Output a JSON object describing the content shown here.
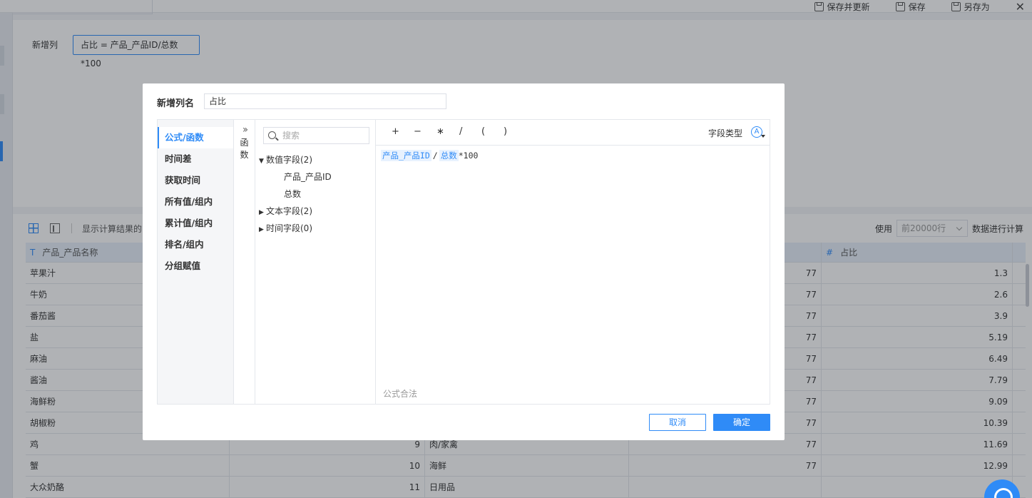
{
  "toolbar": {
    "save_update": "保存并更新",
    "save": "保存",
    "save_as": "另存为",
    "close": "✕"
  },
  "upper": {
    "new_column_label": "新增列",
    "formula_chip": "占比 = 产品_产品ID/总数*100"
  },
  "lower": {
    "show_calc": "显示计算结果的",
    "use_label": "使用",
    "rows_option": "前20000行",
    "calc_suffix": "数据进行计算"
  },
  "table": {
    "headers": [
      {
        "type_icon": "T",
        "label": "产品_产品名称"
      },
      {
        "type_icon": "",
        "label": ""
      },
      {
        "type_icon": "",
        "label": ""
      },
      {
        "type_icon": "",
        "label": ""
      },
      {
        "type_icon": "#",
        "label": "占比"
      }
    ],
    "rows": [
      [
        "苹果汁",
        "",
        "",
        "77",
        "1.3"
      ],
      [
        "牛奶",
        "",
        "",
        "77",
        "2.6"
      ],
      [
        "番茄酱",
        "",
        "",
        "77",
        "3.9"
      ],
      [
        "盐",
        "",
        "",
        "77",
        "5.19"
      ],
      [
        "麻油",
        "",
        "",
        "77",
        "6.49"
      ],
      [
        "酱油",
        "",
        "",
        "77",
        "7.79"
      ],
      [
        "海鲜粉",
        "",
        "",
        "77",
        "9.09"
      ],
      [
        "胡椒粉",
        "",
        "",
        "77",
        "10.39"
      ],
      [
        "鸡",
        "9",
        "肉/家禽",
        "77",
        "11.69"
      ],
      [
        "蟹",
        "10",
        "海鲜",
        "77",
        "12.99"
      ],
      [
        "大众奶酪",
        "11",
        "日用品",
        "",
        ""
      ]
    ]
  },
  "dialog": {
    "name_label": "新增列名",
    "name_value": "占比",
    "categories": [
      "公式/函数",
      "时间差",
      "获取时间",
      "所有值/组内",
      "累计值/组内",
      "排名/组内",
      "分组赋值"
    ],
    "func_toggle": "函数",
    "search_placeholder": "搜索",
    "tree": {
      "numeric": "数值字段(2)",
      "numeric_children": [
        "产品_产品ID",
        "总数"
      ],
      "text": "文本字段(2)",
      "time": "时间字段(0)"
    },
    "ops": [
      "+",
      "−",
      "∗",
      "/",
      "(",
      ")"
    ],
    "field_type_label": "字段类型",
    "field_type_icon": "A",
    "formula": {
      "token1": "产品_产品ID",
      "op1": "/",
      "token2": "总数",
      "tail": "*100"
    },
    "validity": "公式合法",
    "cancel": "取消",
    "confirm": "确定"
  },
  "colors": {
    "accent": "#2f8bf7",
    "token_bg": "#e8f2fe"
  }
}
